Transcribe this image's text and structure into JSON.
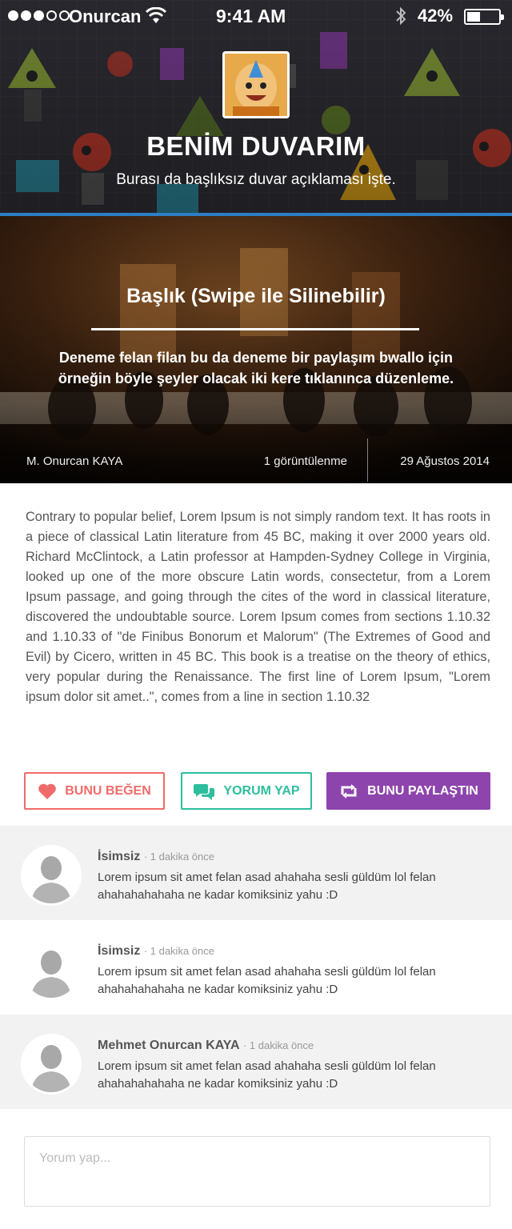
{
  "status_bar": {
    "carrier": "Onurcan",
    "time": "9:41 AM",
    "battery": "42%",
    "battery_level": 0.42
  },
  "wall": {
    "title": "BENİM DUVARIM",
    "subtitle": "Burası da başlıksız duvar açıklaması işte."
  },
  "post": {
    "title": "Başlık (Swipe ile Silinebilir)",
    "excerpt": "Deneme felan filan bu da deneme bir paylaşım bwallo için örneğin böyle şeyler olacak iki kere tıklanınca düzenleme.",
    "author": "M. Onurcan KAYA",
    "views": "1 görüntülenme",
    "date": "29 Ağustos 2014",
    "body": "Contrary to popular belief, Lorem Ipsum is not simply random text. It has roots in a piece of classical Latin literature from 45 BC, making it over 2000 years old. Richard McClintock, a Latin professor at Hampden-Sydney College in Virginia, looked up one of the more obscure Latin words, consectetur, from a Lorem Ipsum passage, and going through the cites of the word in classical literature, discovered the undoubtable source. Lorem Ipsum comes from sections 1.10.32 and 1.10.33 of \"de Finibus Bonorum et Malorum\" (The Extremes of Good and Evil) by Cicero, written in 45 BC. This book is a treatise on the theory of ethics, very popular during the Renaissance. The first line of Lorem Ipsum, \"Lorem ipsum dolor sit amet..\", comes from a line in section 1.10.32"
  },
  "actions": {
    "like": "BUNU BEĞEN",
    "comment": "YORUM YAP",
    "share": "BUNU PAYLAŞTIN",
    "like_color": "#ef6b6b",
    "comment_color": "#2dbf9d",
    "share_color": "#8e44ad"
  },
  "comments": [
    {
      "name": "İsimsiz",
      "time": "· 1 dakika önce",
      "text": "Lorem ipsum sit amet felan asad ahahaha sesli güldüm lol felan ahahahahahaha ne kadar komiksiniz yahu :D"
    },
    {
      "name": "İsimsiz",
      "time": "· 1 dakika önce",
      "text": "Lorem ipsum sit amet felan asad ahahaha sesli güldüm lol felan ahahahahahaha ne kadar komiksiniz yahu :D"
    },
    {
      "name": "Mehmet Onurcan KAYA",
      "time": "· 1 dakika önce",
      "text": "Lorem ipsum sit amet felan asad ahahaha sesli güldüm lol felan ahahahahahaha ne kadar komiksiniz yahu :D"
    }
  ],
  "comment_input": {
    "placeholder": "Yorum yap..."
  },
  "icons": {
    "signal": "signal-dots-icon",
    "wifi": "wifi-icon",
    "bluetooth": "bluetooth-icon",
    "battery": "battery-icon",
    "like": "heart-icon",
    "comment": "chat-bubbles-icon",
    "share": "repost-icon",
    "avatar": "person-silhouette-icon"
  }
}
